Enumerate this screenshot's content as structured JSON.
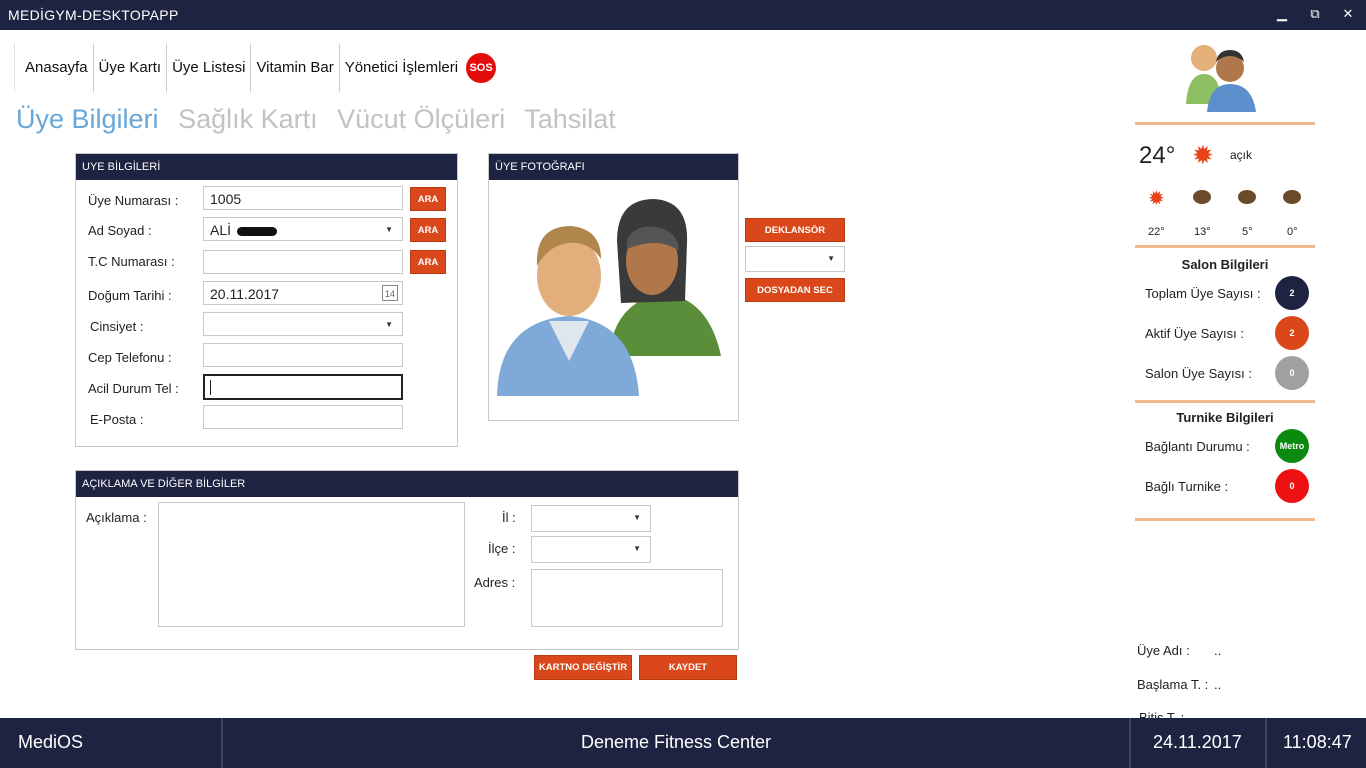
{
  "window": {
    "title": "MEDİGYM-DESKTOPAPP",
    "minimize": "▁",
    "restore": "⧉",
    "close": "✕"
  },
  "nav": {
    "items": [
      "Anasayfa",
      "Üye Kartı",
      "Üye Listesi",
      "Vitamin Bar",
      "Yönetici İşlemleri"
    ],
    "sos": "SOS"
  },
  "tabs": [
    "Üye Bilgileri",
    "Sağlık Kartı",
    "Vücut Ölçüleri",
    "Tahsilat"
  ],
  "member_panel": {
    "header": "UYE BİLGİLERİ",
    "fields": {
      "number_label": "Üye Numarası :",
      "number_value": "1005",
      "name_label": "Ad Soyad :",
      "name_value": "ALİ",
      "tc_label": "T.C Numarası :",
      "birth_label": "Doğum Tarihi :",
      "birth_value": "20.11.2017",
      "gender_label": "Cinsiyet :",
      "phone_label": "Cep Telefonu :",
      "emergency_label": "Acil Durum Tel :",
      "email_label": "E-Posta :"
    },
    "search_button": "ARA",
    "calendar_day": "14"
  },
  "photo_panel": {
    "header": "ÜYE FOTOĞRAFI",
    "shutter_button": "DEKLANSÖR",
    "file_button": "DOSYADAN SEC"
  },
  "notes_panel": {
    "header": "AÇIKLAMA VE DİĞER BİLGİLER",
    "description_label": "Açıklama :",
    "city_label": "İl :",
    "district_label": "İlçe :",
    "address_label": "Adres :"
  },
  "actions": {
    "change_card": "KARTNO DEĞİŞTİR",
    "save": "KAYDET"
  },
  "weather": {
    "temp": "24°",
    "desc": "açık",
    "forecast": [
      {
        "temp": "22°",
        "icon": "sun-icon"
      },
      {
        "temp": "13°",
        "icon": "cloud-icon"
      },
      {
        "temp": "5°",
        "icon": "cloud-icon"
      },
      {
        "temp": "0°",
        "icon": "cloud-icon"
      }
    ]
  },
  "salon": {
    "title": "Salon Bilgileri",
    "rows": [
      {
        "label": "Toplam Üye Sayısı :",
        "value": "2",
        "color": "#1d2340"
      },
      {
        "label": "Aktif Üye Sayısı :",
        "value": "2",
        "color": "#d9471b"
      },
      {
        "label": "Salon Üye Sayısı :",
        "value": "0",
        "color": "#a0a0a0"
      }
    ]
  },
  "turnstile": {
    "title": "Turnike Bilgileri",
    "rows": [
      {
        "label": "Bağlantı Durumu :",
        "value": "Metro",
        "color": "#0c8a10"
      },
      {
        "label": "Bağlı Turnike :",
        "value": "0",
        "color": "#ee1111"
      }
    ]
  },
  "member_info": {
    "name_label": "Üye Adı :",
    "name_value": "..",
    "start_label": "Başlama T. :",
    "start_value": "..",
    "end_label": "Bitiş T. :"
  },
  "taskbar": {
    "os": "MediOS",
    "center": "Deneme Fitness Center",
    "date": "24.11.2017",
    "time": "11:08:47"
  }
}
